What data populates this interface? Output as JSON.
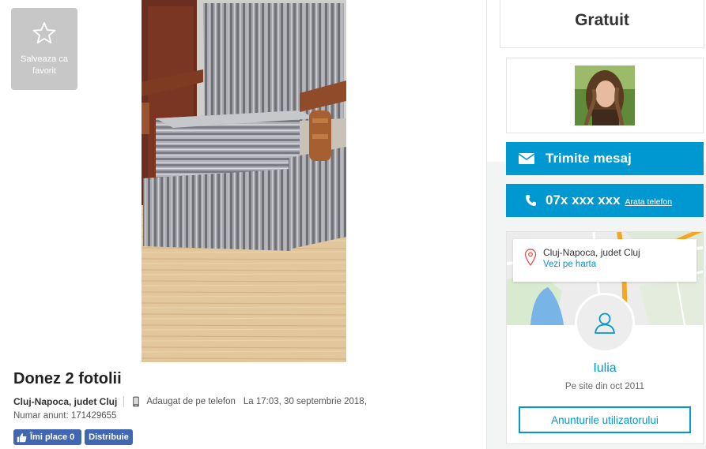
{
  "favorite": {
    "label": "Salveaza ca favorit"
  },
  "ad": {
    "title": "Donez 2 fotolii",
    "location": "Cluj-Napoca, judet Cluj",
    "added_via": "Adaugat de pe telefon",
    "date": "La 17:03, 30 septembrie 2018,",
    "ad_number": "Numar anunt: 171429655"
  },
  "social": {
    "like_label": "Îmi place 0",
    "share_label": "Distribuie"
  },
  "price": {
    "label": "Gratuit"
  },
  "contact": {
    "message_label": "Trimite mesaj",
    "phone_masked": "07x xxx xxx",
    "show_phone_label": "Arata telefon"
  },
  "location_card": {
    "city": "Cluj-Napoca, judet Cluj",
    "map_link": "Vezi pe harta"
  },
  "user": {
    "name": "Iulia",
    "since": "Pe site din oct 2011",
    "ads_button": "Anunturile utilizatorului"
  },
  "colors": {
    "accent": "#0098d0",
    "facebook": "#4267b2",
    "favorite_bg": "#c7c7c7"
  }
}
